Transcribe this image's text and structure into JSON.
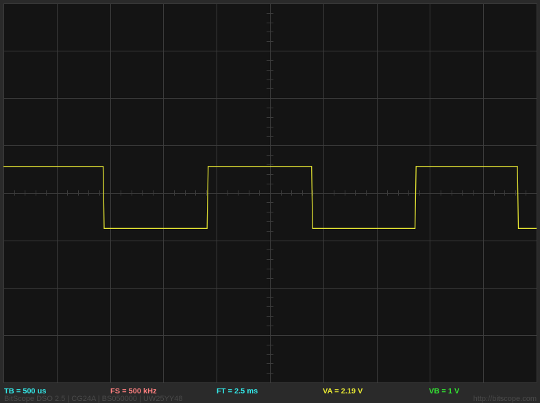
{
  "colors": {
    "screen_bg": "#141414",
    "frame_bg": "#2a2a2a",
    "grid": "#3c3c3c",
    "trace": "#e6e633",
    "tb": "#33e6e6",
    "fs": "#ff8080",
    "ft": "#33e6e6",
    "va": "#e6e633",
    "vb": "#33e633",
    "footer": "#4a4a4a"
  },
  "status_bar": {
    "tb": "TB = 500 us",
    "fs": "FS = 500 kHz",
    "ft": "FT = 2.5 ms",
    "va": "VA = 2.19 V",
    "vb": "VB = 1 V"
  },
  "footer": {
    "left": "BitScope DSO 2.5 | CG24A | BS050000 | UW25YY48",
    "right": "http://bitscope.com"
  },
  "chart_data": {
    "type": "line",
    "grid": true,
    "divisions": {
      "x": 10,
      "y": 8
    },
    "xlim": [
      0,
      5
    ],
    "ylim": [
      -4,
      4
    ],
    "series": [
      {
        "x": [
          0,
          1.87,
          1.89,
          3.82,
          3.84,
          5.78,
          5.8,
          7.72,
          7.74,
          9.64,
          9.66,
          10
        ],
        "y": [
          0.56,
          0.56,
          -0.75,
          -0.75,
          0.56,
          0.56,
          -0.75,
          -0.75,
          0.56,
          0.56,
          -0.75,
          -0.75
        ]
      }
    ]
  }
}
